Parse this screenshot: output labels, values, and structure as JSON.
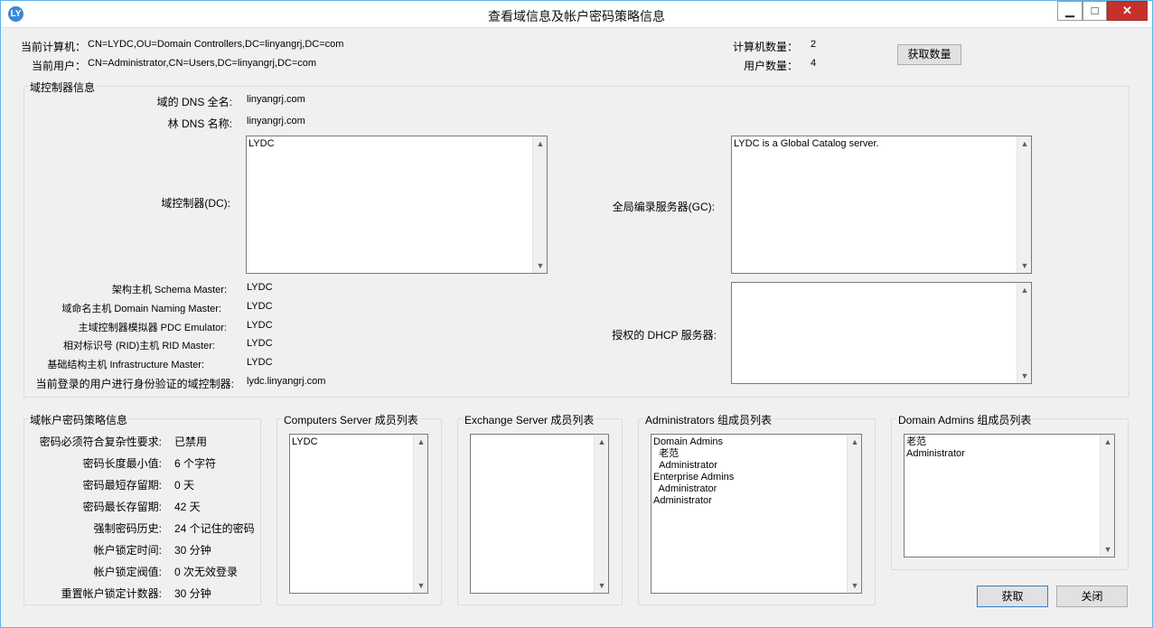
{
  "window": {
    "title": "查看域信息及帐户密码策略信息",
    "minimize": "▁",
    "maximize": "□",
    "close": "✕"
  },
  "header": {
    "computer_label": "当前计算机：",
    "computer_value": "CN=LYDC,OU=Domain Controllers,DC=linyangrj,DC=com",
    "user_label": "当前用户：",
    "user_value": "CN=Administrator,CN=Users,DC=linyangrj,DC=com",
    "computer_count_label": "计算机数量：",
    "computer_count": "2",
    "user_count_label": "用户数量：",
    "user_count": "4",
    "get_count_button": "获取数量"
  },
  "domain_controller": {
    "group_title": "域控制器信息",
    "dns_fullname_label": "域的 DNS 全名:",
    "dns_fullname": "linyangrj.com",
    "forest_dns_label": "林 DNS 名称:",
    "forest_dns": "linyangrj.com",
    "dc_label": "域控制器(DC):",
    "dc_list": "LYDC",
    "gc_label": "全局编录服务器(GC):",
    "gc_list": "LYDC is a Global Catalog server.",
    "dhcp_label": "授权的 DHCP 服务器:",
    "dhcp_list": "",
    "roles": [
      {
        "label": "架构主机 Schema Master:",
        "value": "LYDC"
      },
      {
        "label": "域命名主机 Domain Naming Master:",
        "value": "LYDC"
      },
      {
        "label": "主域控制器模拟器 PDC Emulator:",
        "value": "LYDC"
      },
      {
        "label": "相对标识号 (RID)主机 RID Master:",
        "value": "LYDC"
      },
      {
        "label": "基础结构主机 Infrastructure Master:",
        "value": "LYDC"
      },
      {
        "label": "当前登录的用户进行身份验证的域控制器:",
        "value": "lydc.linyangrj.com"
      }
    ]
  },
  "password_policy": {
    "group_title": "域帐户密码策略信息",
    "items": [
      {
        "label": "密码必须符合复杂性要求:",
        "value": "已禁用"
      },
      {
        "label": "密码长度最小值:",
        "value": "6 个字符"
      },
      {
        "label": "密码最短存留期:",
        "value": "0 天"
      },
      {
        "label": "密码最长存留期:",
        "value": "42 天"
      },
      {
        "label": "强制密码历史:",
        "value": "24 个记住的密码"
      },
      {
        "label": "帐户锁定时间:",
        "value": "30 分钟"
      },
      {
        "label": "帐户锁定阀值:",
        "value": "0 次无效登录"
      },
      {
        "label": "重置帐户锁定计数器:",
        "value": "30 分钟"
      }
    ]
  },
  "member_lists": {
    "computers_server": {
      "title": "Computers Server 成员列表",
      "content": "LYDC"
    },
    "exchange_server": {
      "title": "Exchange Server 成员列表",
      "content": ""
    },
    "administrators": {
      "title": "Administrators 组成员列表",
      "content": "Domain Admins\n  老范\n  Administrator\nEnterprise Admins\n  Administrator\nAdministrator"
    },
    "domain_admins": {
      "title": "Domain Admins 组成员列表",
      "content": "老范\nAdministrator"
    }
  },
  "footer": {
    "get_button": "获取",
    "close_button": "关闭"
  },
  "scroll": {
    "up": "▲",
    "down": "▼"
  }
}
